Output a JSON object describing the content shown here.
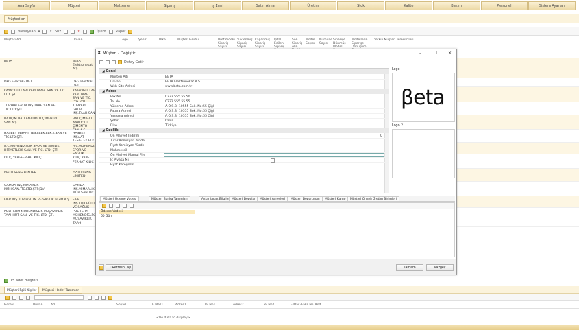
{
  "topnav": [
    "Ana Sayfa",
    "Müşteri",
    "Malzeme",
    "Sipariş",
    "İş Emri",
    "Satın Alma",
    "Üretim",
    "Stok",
    "Kalite",
    "Bakım",
    "Personel",
    "Sistem Ayarları"
  ],
  "subtab": "Müşteriler",
  "toolbar": {
    "layout_label": "Varsayılan",
    "filter_label": "Süz",
    "process_label": "İşlem",
    "report_label": "Rapor"
  },
  "grid_headers": [
    "Müşteri Adı",
    "Ünvan",
    "Logo",
    "Şehir",
    "Ülke",
    "Müşteri Grubu",
    "Üretimdeki Sipariş Sayısı",
    "Yüklenmiş Sipariş Sayısı",
    "Kapanmış Sipariş Sayısı",
    "İptal Edilen Sipariş Sayısı",
    "Son Sipariş Alın Tarihi",
    "Model Sayısı",
    "Numune Sayısı",
    "Siparişe Dönmüş Model Sayısı",
    "Modellerin Siparişe Dönüşüm Oranı",
    "Yetkili Müşteri Temsilcileri"
  ],
  "rows": [
    {
      "name": "BETA",
      "title": "BETA Elektronekat A.Ş."
    },
    {
      "name": "DFG Elektrik- DET",
      "title": "DFG Elektrik- DET"
    },
    {
      "name": "KAYAOĞULLARI YAPI TAAH. SAN VE TİC. LTD. ŞTİ.",
      "title": "KAYAOĞULLARI YAPI TAAH. SAN VE TİC. LTD. ŞTİ."
    },
    {
      "name": "TURYAPI GRUP İNŞ.TAAH.SAN.VE TİC.LTD.ŞTİ.",
      "title": "TURYAPI GRUP İNŞ.TAAH.SAN.VE TİC.LTD.ŞTİ."
    },
    {
      "name": "BATIÇİM BATI ANADOLU ÇİMENTO SAN.A.Ş.",
      "title": "BATIÇİM BATI ANADOLU ÇİMENTO SAN.A.Ş."
    },
    {
      "name": "HASBEY İNŞAAT TES.ELEK.ELK.T.SAN.VE TİC.LTD.ŞTİ.",
      "title": "HASBEY İNŞAAT TES.ELEK.ELK.T.SAN VE TİC.LTD.ŞTİ."
    },
    {
      "name": "A.C.MÜHENDİSLİK SPOR VE SAĞLIK HİZMETLERİ SAN. VE TİC. LTD. ŞTİ.",
      "title": "A.C.MÜHENDİSLİK SPOR VE SAĞLIK HİZMETLERİ SAN."
    },
    {
      "name": "KILIÇ YAPI-FERHAT KILIÇ",
      "title": "KILIÇ YAPI-FERHAT KILIÇ"
    },
    {
      "name": "MATH SENG LIMITED",
      "title": "MATH SENG LIMITED"
    },
    {
      "name": "GAMDA İNŞ.MİMARLIK MÜH.SAN.TİC.LTD.ŞTİ.(DV)",
      "title": "GAMDA İNŞ.MİMARLIK MÜH.SAN.TİC.LTD."
    },
    {
      "name": "FİER İNŞ.TUR.EĞİTİM VE SAĞLIK HİZM.A.Ş.",
      "title": "FİER İNŞ.TUR.EĞİTİM VE SAĞLIK HİZM.A."
    },
    {
      "name": "POLİTERM MÜHENDİSLİK MUŞAVİRLİK TAAHHÜT SAN. VE TİC. LTD. ŞTİ.",
      "title": "POLİTERM MÜHENDİSLİK MUŞAVİRLİK TAAH"
    }
  ],
  "row_count": "15 adet müşteri",
  "lower_tabs": [
    "Müşteri İlgili Kişiler",
    "Müşteri Hedef Tanımları"
  ],
  "lower_headers": [
    "Görevi",
    "Ünvan",
    "Ad",
    "Soyad",
    "E Mail1",
    "Adres1",
    "Tel No1",
    "Adres2",
    "Tel No2",
    "E Mail2",
    "Faks No",
    "Kod"
  ],
  "no_data": "<No data to display>",
  "dialog": {
    "title": "Müşteri - Değiştir",
    "toolbar_label": "Detay Getir",
    "sections": {
      "genel": "Genel",
      "adres": "Adres",
      "ozellik": "Özellik"
    },
    "genel_fields": [
      {
        "label": "Müşteri Adı",
        "value": "BETA"
      },
      {
        "label": "Ünvan",
        "value": "BETA Elektronekat A.Ş."
      },
      {
        "label": "Web Site Adresi",
        "value": "www.beta.com.tr"
      }
    ],
    "adres_fields": [
      {
        "label": "Fax No",
        "value": "0232 555 55 50"
      },
      {
        "label": "Tel No",
        "value": "0232 555 55 55"
      },
      {
        "label": "Yükleme Adresi",
        "value": "A.O.S.B. 10555 Sok. No:55 Çiğli"
      },
      {
        "label": "Fatura Adresi",
        "value": "A.O.S.B. 10555 Sok. No:55 Çiğli"
      },
      {
        "label": "Yazışma Adresi",
        "value": "A.O.S.B. 10555 Sok. No:55 Çiğli"
      },
      {
        "label": "Şehir",
        "value": "İzmir"
      },
      {
        "label": "Ülke",
        "value": "Türkiye"
      }
    ],
    "ozellik_fields": [
      {
        "label": "Ön Maliyet İndirim",
        "value": "0"
      },
      {
        "label": "Tutar Komisyon Yüzde",
        "value": ""
      },
      {
        "label": "Fiyat Komisyon Yüzde",
        "value": ""
      },
      {
        "label": "Muhmessil",
        "value": ""
      },
      {
        "label": "Ön Maliyet Mamul Fire",
        "value": ""
      },
      {
        "label": "İç Piyasa Mı",
        "value": ""
      },
      {
        "label": "Fiyat Kategorisi",
        "value": ""
      }
    ],
    "logo_label": "Logo",
    "logo2_label": "Logo 2",
    "logo_text": "βeta",
    "bottom_tabs": [
      "Müşteri Ödeme Vadesi",
      "Müşteri Banka Tanımları",
      "Aktarılacak Bilgiler",
      "Müşteri Depoları",
      "Müşteri Adresleri",
      "Müşteri Departman",
      "Müşteri Kargo",
      "Müşteri Onaylı Üretim Birimleri"
    ],
    "panel_header": "Ödeme Vadesi",
    "panel_value": "60 Gün",
    "refresh_label": "CDRefreshCap",
    "ok_label": "Tamam",
    "cancel_label": "Vazgeç"
  }
}
